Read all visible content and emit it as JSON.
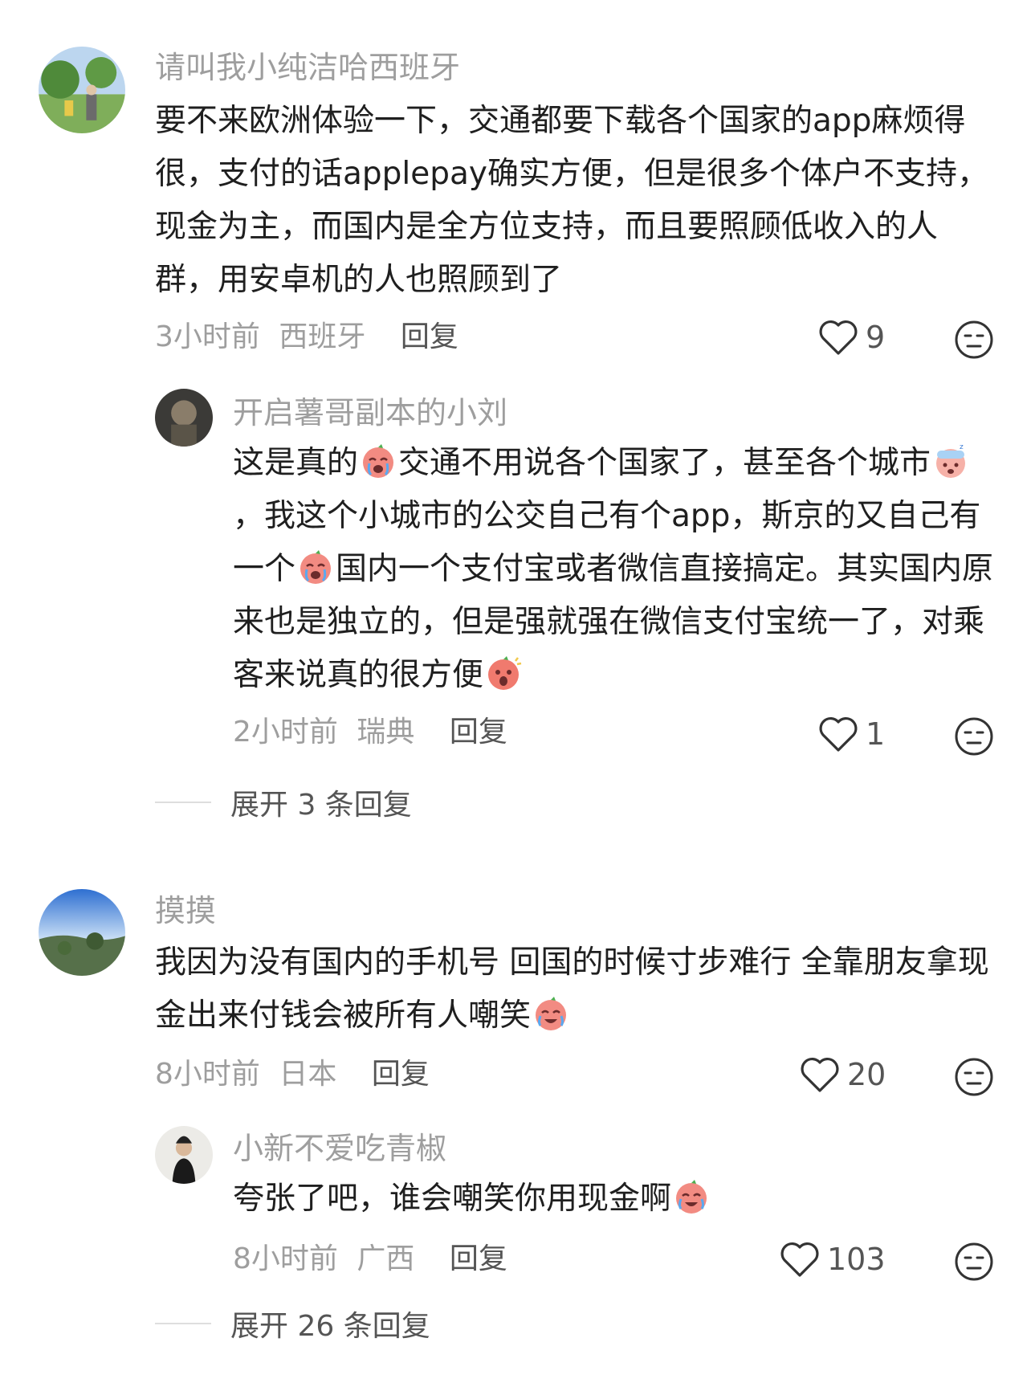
{
  "comments": [
    {
      "username": "请叫我小纯洁哈西班牙",
      "text": "要不来欧洲体验一下，交通都要下载各个国家的app麻烦得很，支付的话applepay确实方便，但是很多个体户不支持，现金为主，而国内是全方位支持，而且要照顾低收入的人群，用安卓机的人也照顾到了",
      "time": "3小时前",
      "location": "西班牙",
      "reply_label": "回复",
      "likes": "9",
      "replies": [
        {
          "username": "开启薯哥副本的小刘",
          "text_parts": [
            "这是真的",
            "交通不用说各个国家了，甚至各个城市",
            "，我这个小城市的公交自己有个app，斯京的又自己有一个",
            "国内一个支付宝或者微信直接搞定。其实国内原来也是独立的，但是强就强在微信支付宝统一了，对乘客来说真的很方便"
          ],
          "emojis": [
            "crying-face-icon",
            "sleepy-face-icon",
            "crying-face-icon",
            "surprised-face-icon"
          ],
          "time": "2小时前",
          "location": "瑞典",
          "reply_label": "回复",
          "likes": "1"
        }
      ],
      "expand_label": "展开 3 条回复"
    },
    {
      "username": "摸摸",
      "text": "我因为没有国内的手机号 回国的时候寸步难行 全靠朋友拿现金出来付钱会被所有人嘲笑",
      "emoji": "laughing-crying-face-icon",
      "time": "8小时前",
      "location": "日本",
      "reply_label": "回复",
      "likes": "20",
      "replies": [
        {
          "username": "小新不爱吃青椒",
          "text": "夸张了吧，谁会嘲笑你用现金啊",
          "emoji": "laughing-crying-face-icon",
          "time": "8小时前",
          "location": "广西",
          "reply_label": "回复",
          "likes": "103"
        }
      ],
      "expand_label": "展开 26 条回复"
    }
  ],
  "colors": {
    "meta": "#9e9e9e",
    "text": "#1f1f1f",
    "emoji": "#f28b82"
  }
}
